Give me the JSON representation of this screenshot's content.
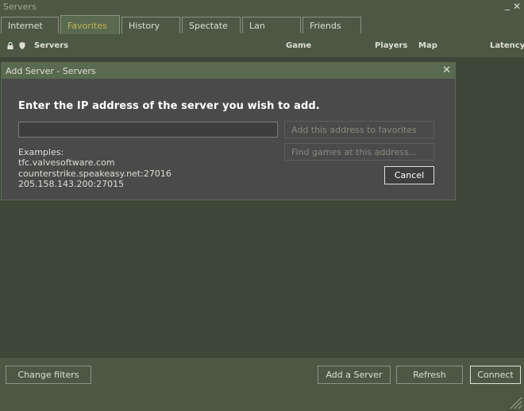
{
  "window": {
    "title": "Servers",
    "minimize_glyph": "_",
    "close_glyph": "✕"
  },
  "tabs": [
    {
      "label": "Internet"
    },
    {
      "label": "Favorites",
      "active": true
    },
    {
      "label": "History"
    },
    {
      "label": "Spectate"
    },
    {
      "label": "Lan"
    },
    {
      "label": "Friends"
    }
  ],
  "columns": {
    "lock_icon": "lock-icon",
    "shield_icon": "shield-icon",
    "servers": "Servers",
    "game": "Game",
    "players": "Players",
    "map": "Map",
    "latency": "Latency"
  },
  "dialog": {
    "title": "Add Server - Servers",
    "close_glyph": "✕",
    "prompt": "Enter the IP address of the server you wish to add.",
    "ip_value": "",
    "add_favorites_label": "Add this address to favorites",
    "find_games_label": "Find games at this address...",
    "cancel_label": "Cancel",
    "examples_label": "Examples:",
    "examples": [
      "tfc.valvesoftware.com",
      "counterstrike.speakeasy.net:27016",
      "205.158.143.200:27015"
    ]
  },
  "bottom": {
    "change_filters": "Change filters",
    "add_server": "Add a Server",
    "refresh": "Refresh",
    "connect": "Connect"
  },
  "colors": {
    "panel": "#4c5844",
    "list_bg": "#3e4637",
    "active_tab_text": "#c4b550",
    "dialog_bg": "#4a4a4a",
    "text": "#dedfd6"
  }
}
